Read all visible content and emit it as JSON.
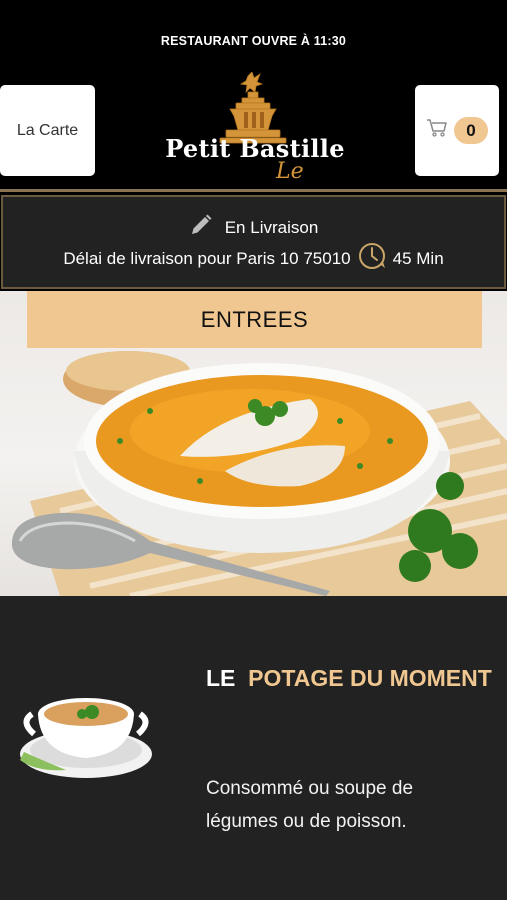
{
  "status_banner": "RESTAURANT OUVRE À 11:30",
  "header": {
    "menu_label": "La Carte",
    "logo_text": "Petit Bastille",
    "cart_count": "0",
    "cart_icon": "cart-icon"
  },
  "delivery": {
    "mode": "En Livraison",
    "time_text": "Délai de livraison pour Paris 10 75010",
    "time_value": "45 Min",
    "icons": [
      "pencil-icon",
      "clock-icon"
    ]
  },
  "category": {
    "title": "ENTREES"
  },
  "product": {
    "title_prefix": "LE",
    "title_accent": "POTAGE DU MOMENT",
    "description": "Consommé ou soupe de légumes ou de poisson."
  },
  "colors": {
    "accent": "#f0c790",
    "background": "#000000",
    "panel": "#222222",
    "divider": "#8a7350"
  }
}
